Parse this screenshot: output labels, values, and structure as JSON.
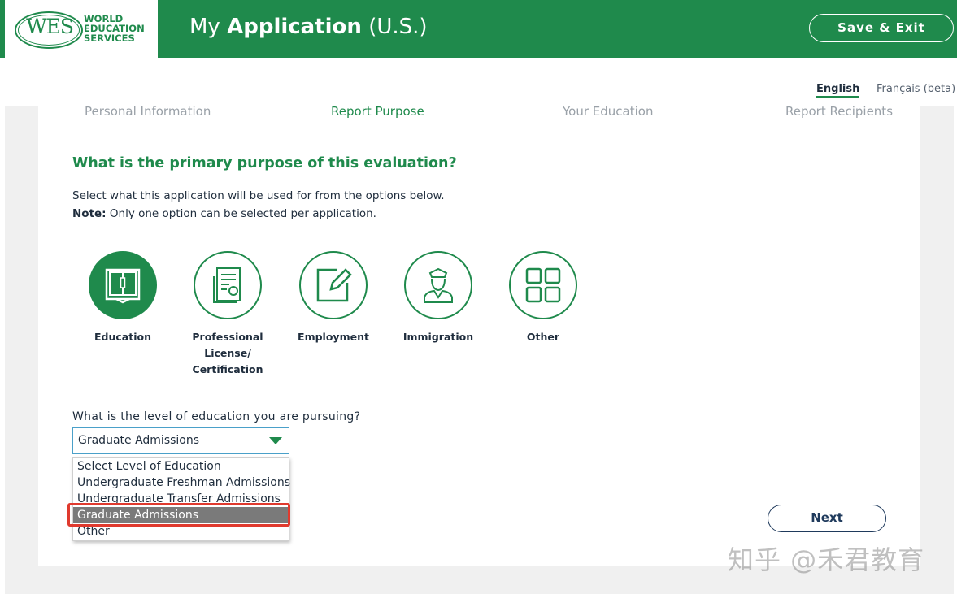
{
  "header": {
    "logo_mark": "WES",
    "logo_lines": [
      "WORLD",
      "EDUCATION",
      "SERVICES"
    ],
    "title_prefix": "My",
    "title_main": "Application",
    "title_suffix": "(U.S.)",
    "save_exit_label": "Save & Exit"
  },
  "language": {
    "english": "English",
    "french": "Français (beta)"
  },
  "steps": [
    {
      "label": "Personal Information",
      "active": false
    },
    {
      "label": "Report Purpose",
      "active": true
    },
    {
      "label": "Your Education",
      "active": false
    },
    {
      "label": "Report Recipients",
      "active": false
    }
  ],
  "main": {
    "question": "What is the primary purpose of this evaluation?",
    "intro": "Select what this application will be used for from the options below.",
    "note_label": "Note:",
    "note_text": " Only one option can be selected per application."
  },
  "purpose_options": [
    {
      "label": "Education",
      "icon": "book-icon",
      "selected": true
    },
    {
      "label": "Professional License/ Certification",
      "icon": "certificate-icon",
      "selected": false
    },
    {
      "label": "Employment",
      "icon": "edit-icon",
      "selected": false
    },
    {
      "label": "Immigration",
      "icon": "officer-icon",
      "selected": false
    },
    {
      "label": "Other",
      "icon": "grid-icon",
      "selected": false
    }
  ],
  "education_level": {
    "label": "What is the level of education you are pursuing?",
    "selected": "Graduate Admissions",
    "options": [
      "Select Level of Education",
      "Undergraduate Freshman Admissions",
      "Undergraduate Transfer Admissions",
      "Graduate Admissions",
      "Other"
    ],
    "highlighted_index": 3
  },
  "next_label": "Next",
  "watermark": "知乎 @禾君教育",
  "colors": {
    "brand_green": "#1f8a4c",
    "highlight_red": "#e03a2e",
    "selected_row": "#7a7a7a"
  }
}
